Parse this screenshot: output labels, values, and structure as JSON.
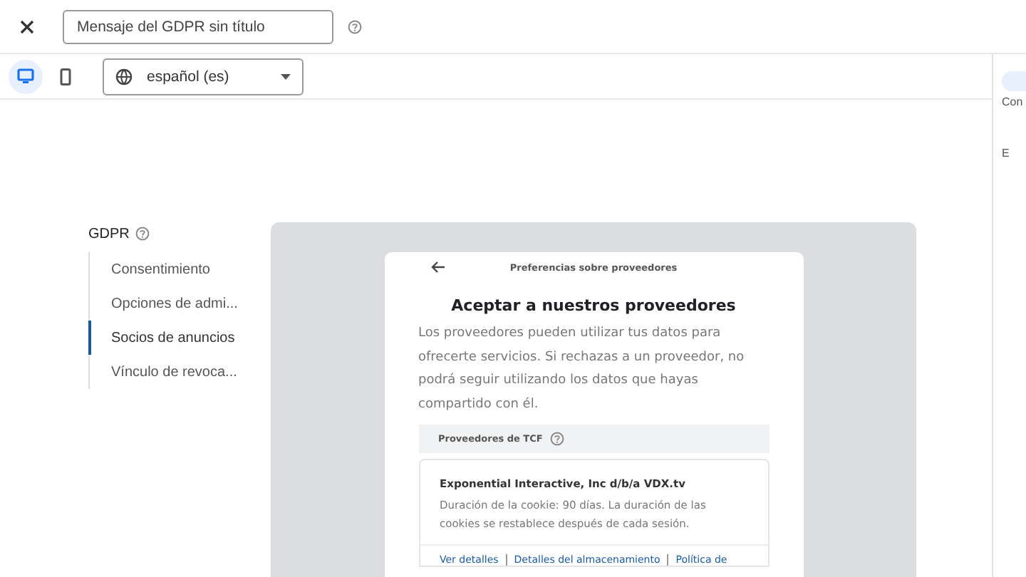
{
  "header": {
    "title_field": {
      "value": "Mensaje del GDPR sin título"
    }
  },
  "toolbar": {
    "devices": [
      {
        "kind": "desktop",
        "selected": true
      },
      {
        "kind": "mobile",
        "selected": false
      }
    ],
    "language": "español (es)"
  },
  "nav": {
    "title": "GDPR",
    "items": [
      {
        "label": "Consentimiento",
        "selected": false
      },
      {
        "label": "Opciones de admi...",
        "selected": false
      },
      {
        "label": "Socios de anuncios",
        "selected": true
      },
      {
        "label": "Vínculo de revoca...",
        "selected": false
      }
    ]
  },
  "preview": {
    "header": "Preferencias sobre proveedores",
    "title": "Aceptar a nuestros proveedores",
    "body": "Los proveedores pueden utilizar tus datos para ofrecerte servicios. Si rechazas a un proveedor, no podrá seguir utilizando los datos que hayas compartido con él.",
    "section": "Proveedores de TCF",
    "vendor": {
      "name": "Exponential Interactive, Inc d/b/a VDX.tv",
      "description": "Duración de la cookie: 90 días. La duración de las cookies se restablece después de cada sesión.",
      "links": [
        "Ver detalles",
        "Detalles del almacenamiento",
        "Política de"
      ]
    }
  },
  "rail": {
    "items": [
      {
        "label": "Con",
        "selected": true
      },
      {
        "label": "E",
        "selected": false
      }
    ]
  }
}
